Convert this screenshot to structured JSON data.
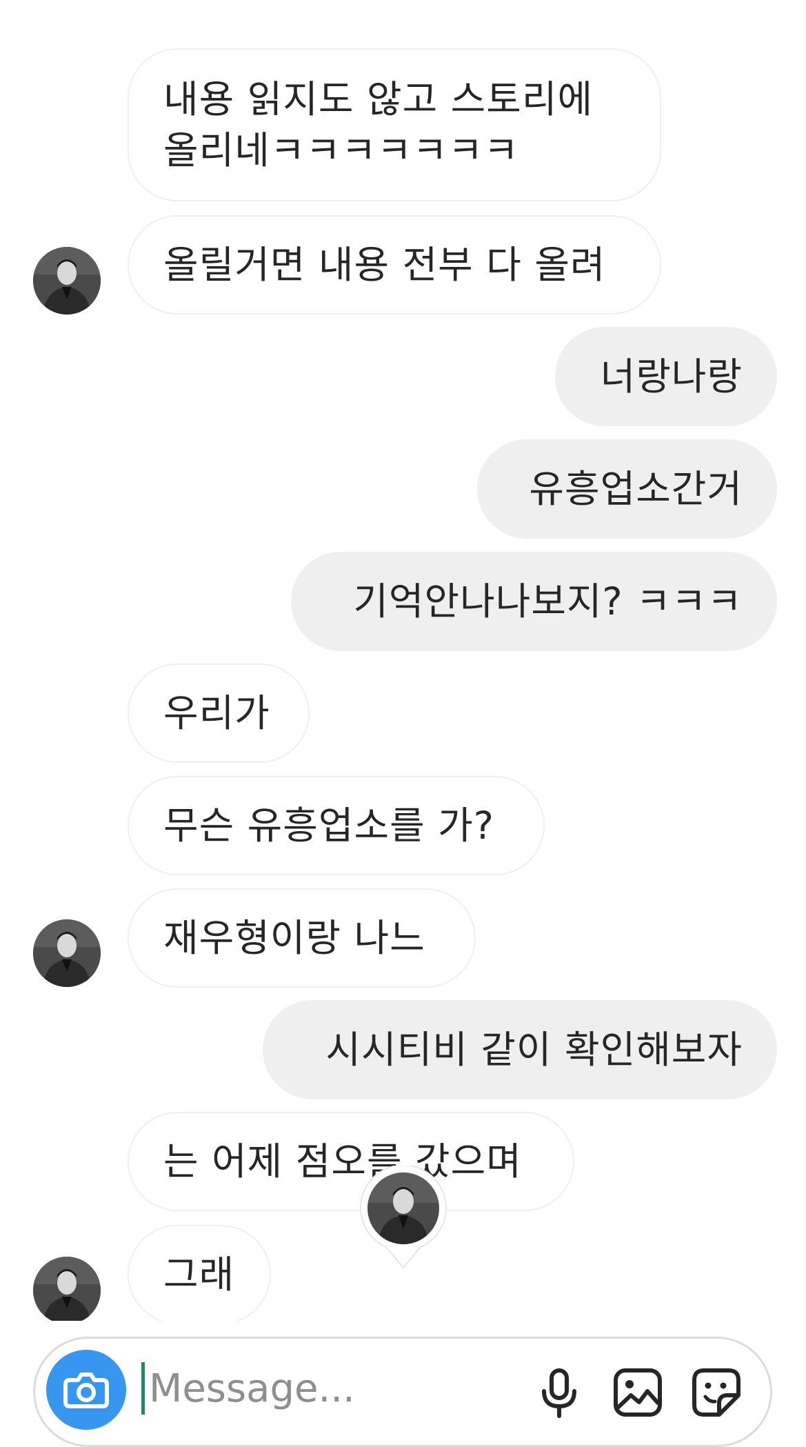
{
  "messages": [
    {
      "side": "in",
      "text": "내용 읽지도 않고 스토리에 올리네ㅋㅋㅋㅋㅋㅋㅋ",
      "lines": [
        "내용 읽지도 않고 스토리에",
        "올리네ㅋㅋㅋㅋㅋㅋㅋ"
      ]
    },
    {
      "side": "in",
      "text": "올릴거면 내용 전부 다 올려"
    },
    {
      "side": "out",
      "text": "너랑나랑"
    },
    {
      "side": "out",
      "text": "유흥업소간거"
    },
    {
      "side": "out",
      "text": "기억안나나보지? ㅋㅋㅋ"
    },
    {
      "side": "in",
      "text": "우리가"
    },
    {
      "side": "in",
      "text": "무슨 유흥업소를 가?"
    },
    {
      "side": "in",
      "text": "재우형이랑 나느"
    },
    {
      "side": "out",
      "text": "시시티비 같이 확인해보자"
    },
    {
      "side": "in",
      "text": "는 어제 점오를 갔으며"
    },
    {
      "side": "in",
      "text": "그래"
    }
  ],
  "composer": {
    "placeholder": "Message...",
    "camera_icon": "camera-icon",
    "tools": [
      "microphone-icon",
      "gallery-icon",
      "sticker-icon"
    ]
  },
  "colors": {
    "outgoing_bubble": "#efefef",
    "incoming_border": "#efefef",
    "camera_button": "#3797f0",
    "text": "#262626",
    "placeholder": "#8e8e8e"
  }
}
